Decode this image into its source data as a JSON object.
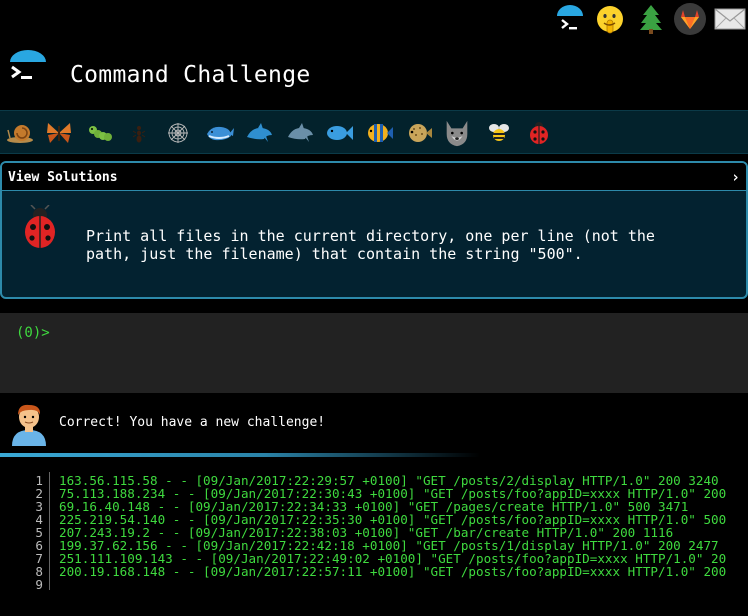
{
  "topbar": {
    "icons": [
      "terminal-logo-icon",
      "shushing-face-icon",
      "tree-icon",
      "gitlab-icon",
      "envelope-icon"
    ]
  },
  "header": {
    "title": "Command Challenge"
  },
  "critters": [
    "snail-icon",
    "butterfly-icon",
    "caterpillar-icon",
    "ant-icon",
    "spider-web-icon",
    "whale-icon",
    "dolphin-icon",
    "dolphin-icon-2",
    "fish-icon",
    "tropical-fish-icon",
    "blowfish-icon",
    "wolf-icon",
    "bee-icon",
    "ladybug-icon"
  ],
  "panel": {
    "label": "View Solutions",
    "chevron": "›",
    "challenge_lines": [
      "Print all files in the current directory, one per line (not the",
      "path, just the filename) that contain the string \"500\"."
    ]
  },
  "terminal": {
    "prompt": "(0)>"
  },
  "message": {
    "text": "Correct! You have a new challenge!"
  },
  "file": {
    "line_numbers": [
      "1",
      "2",
      "3",
      "4",
      "5",
      "6",
      "7",
      "8",
      "9"
    ],
    "lines": [
      "163.56.115.58 - - [09/Jan/2017:22:29:57 +0100] \"GET /posts/2/display HTTP/1.0\" 200 3240",
      "75.113.188.234 - - [09/Jan/2017:22:30:43 +0100] \"GET /posts/foo?appID=xxxx HTTP/1.0\" 200",
      "69.16.40.148 - - [09/Jan/2017:22:34:33 +0100] \"GET /pages/create HTTP/1.0\" 500 3471",
      "225.219.54.140 - - [09/Jan/2017:22:35:30 +0100] \"GET /posts/foo?appID=xxxx HTTP/1.0\" 500",
      "207.243.19.2 - - [09/Jan/2017:22:38:03 +0100] \"GET /bar/create HTTP/1.0\" 200 1116",
      "199.37.62.156 - - [09/Jan/2017:22:42:18 +0100] \"GET /posts/1/display HTTP/1.0\" 200 2477",
      "251.111.109.143 - - [09/Jan/2017:22:49:02 +0100] \"GET /posts/foo?appID=xxxx HTTP/1.0\" 20",
      "200.19.168.148 - - [09/Jan/2017:22:57:11 +0100] \"GET /posts/foo?appID=xxxx HTTP/1.0\" 200",
      ""
    ]
  },
  "colors": {
    "accent": "#2d8aaa",
    "terminal_green": "#3fda3f",
    "panel_bg": "#032230"
  }
}
